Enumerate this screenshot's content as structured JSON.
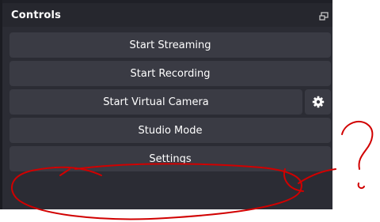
{
  "dock": {
    "title": "Controls",
    "undock_icon": "float-window-icon"
  },
  "controls": {
    "start_streaming": "Start Streaming",
    "start_recording": "Start Recording",
    "start_virtual_camera": "Start Virtual Camera",
    "virtual_camera_settings_icon": "gear-icon",
    "studio_mode": "Studio Mode",
    "settings": "Settings"
  },
  "colors": {
    "dock_background": "#2b2c34",
    "button_background": "#3a3b44",
    "annotation_red": "#d10000"
  }
}
